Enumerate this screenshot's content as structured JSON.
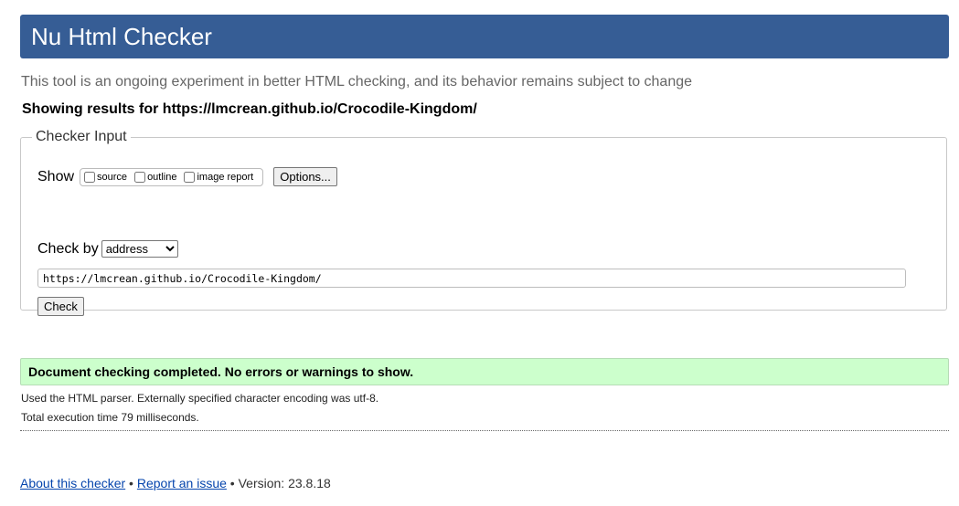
{
  "header": {
    "title": "Nu Html Checker",
    "color": "#365d95"
  },
  "tagline": "This tool is an ongoing experiment in better HTML checking, and its behavior remains subject to change",
  "showing": "Showing results for https://lmcrean.github.io/Crocodile-Kingdom/",
  "checker_input": {
    "legend": "Checker Input",
    "show_label": "Show",
    "options": [
      {
        "label": "source",
        "checked": false
      },
      {
        "label": "outline",
        "checked": false
      },
      {
        "label": "image report",
        "checked": false
      }
    ],
    "options_button": "Options...",
    "check_by_label": "Check by",
    "check_by_value": "address",
    "url_value": "https://lmcrean.github.io/Crocodile-Kingdom/",
    "check_button": "Check"
  },
  "result": {
    "message": "Document checking completed. No errors or warnings to show.",
    "color": "#ccffcc"
  },
  "info": {
    "parser": "Used the HTML parser. Externally specified character encoding was utf-8.",
    "time": "Total execution time 79 milliseconds."
  },
  "footer": {
    "about_link": "About this checker",
    "sep1": " • ",
    "report_link": "Report an issue",
    "version": " • Version: 23.8.18"
  }
}
